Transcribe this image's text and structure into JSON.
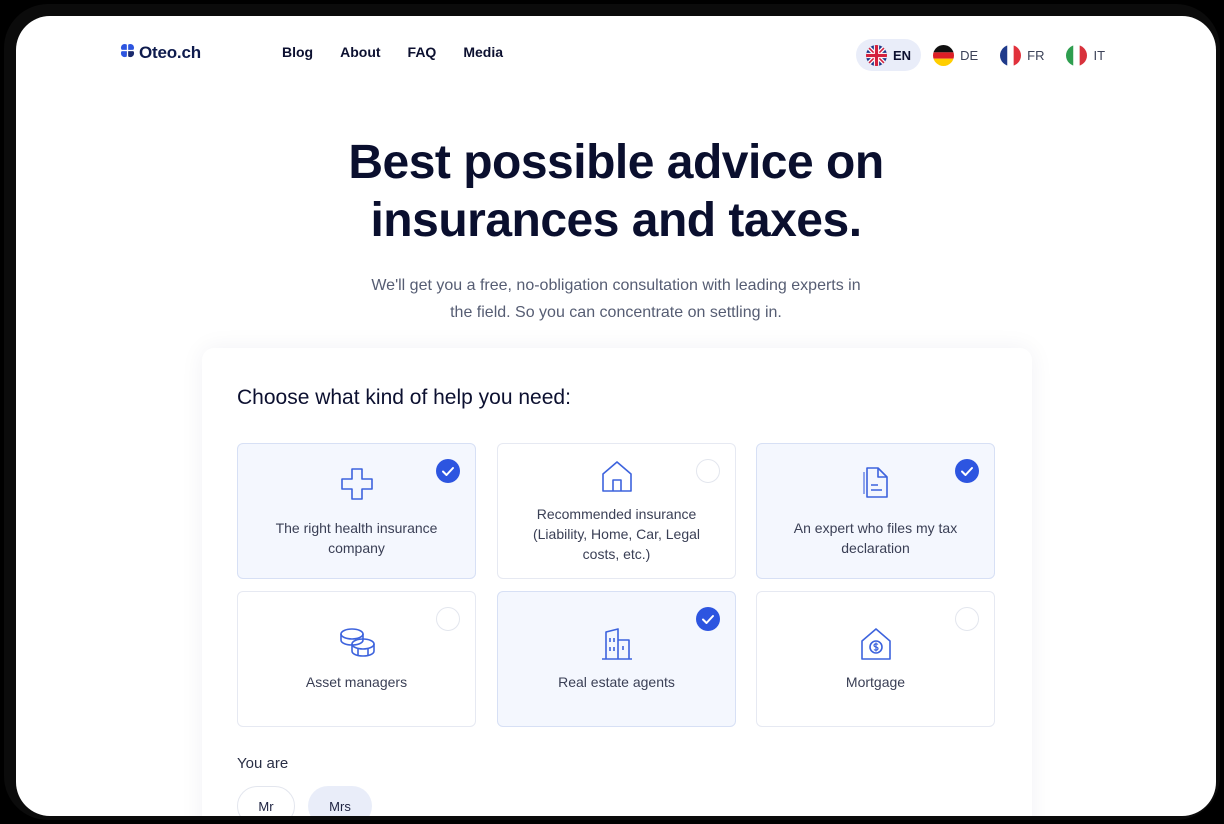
{
  "brand": {
    "name": "Oteo.ch",
    "accent": "#2d55e0"
  },
  "nav": {
    "links": [
      "Blog",
      "About",
      "FAQ",
      "Media"
    ],
    "languages": [
      {
        "code": "EN",
        "flag": "uk-flag-icon",
        "active": true
      },
      {
        "code": "DE",
        "flag": "germany-flag-icon",
        "active": false
      },
      {
        "code": "FR",
        "flag": "france-flag-icon",
        "active": false
      },
      {
        "code": "IT",
        "flag": "italy-flag-icon",
        "active": false
      }
    ]
  },
  "hero": {
    "title_line1": "Best possible advice on",
    "title_line2": "insurances and taxes.",
    "subtitle_line1": "We'll get you a free, no-obligation consultation with leading experts in",
    "subtitle_line2": "the field. So you can concentrate on settling in."
  },
  "form": {
    "question": "Choose what kind of help you need:",
    "options": [
      {
        "label": "The right health insurance company",
        "icon": "medical-cross-icon",
        "selected": true
      },
      {
        "label": "Recommended insurance (Liability, Home, Car, Legal costs, etc.)",
        "icon": "house-icon",
        "selected": false
      },
      {
        "label": "An expert who files my tax declaration",
        "icon": "document-icon",
        "selected": true
      },
      {
        "label": "Asset managers",
        "icon": "coins-icon",
        "selected": false
      },
      {
        "label": "Real estate agents",
        "icon": "buildings-icon",
        "selected": true
      },
      {
        "label": "Mortgage",
        "icon": "house-dollar-icon",
        "selected": false
      }
    ],
    "you_are_label": "You are",
    "salutations": [
      {
        "label": "Mr",
        "selected": false
      },
      {
        "label": "Mrs",
        "selected": true
      }
    ]
  }
}
